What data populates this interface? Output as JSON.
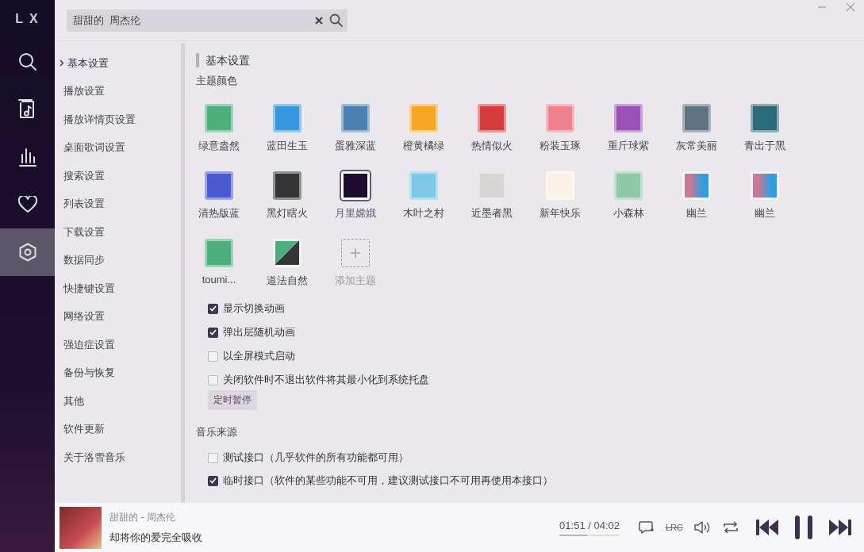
{
  "app_logo": "L X",
  "search": {
    "value": "甜甜的  周杰伦"
  },
  "nav_icons": [
    {
      "kind": "search",
      "selected": false
    },
    {
      "kind": "music-file",
      "selected": false
    },
    {
      "kind": "chart",
      "selected": false
    },
    {
      "kind": "heart",
      "selected": false
    },
    {
      "kind": "settings",
      "selected": true
    }
  ],
  "settings_nav": [
    {
      "label": "基本设置",
      "selected": true
    },
    {
      "label": "播放设置",
      "selected": false
    },
    {
      "label": "播放详情页设置",
      "selected": false
    },
    {
      "label": "桌面歌词设置",
      "selected": false
    },
    {
      "label": "搜索设置",
      "selected": false
    },
    {
      "label": "列表设置",
      "selected": false
    },
    {
      "label": "下载设置",
      "selected": false
    },
    {
      "label": "数据同步",
      "selected": false
    },
    {
      "label": "快捷键设置",
      "selected": false
    },
    {
      "label": "网络设置",
      "selected": false
    },
    {
      "label": "强迫症设置",
      "selected": false
    },
    {
      "label": "备份与恢复",
      "selected": false
    },
    {
      "label": "其他",
      "selected": false
    },
    {
      "label": "软件更新",
      "selected": false
    },
    {
      "label": "关于洛雪音乐",
      "selected": false
    }
  ],
  "section_title": "基本设置",
  "theme_heading": "主题颜色",
  "themes": [
    {
      "name": "绿意盎然",
      "kind": "color",
      "color": "#4daf7c",
      "selected": false
    },
    {
      "name": "蓝田生玉",
      "kind": "color",
      "color": "#3498db",
      "selected": false
    },
    {
      "name": "蛋雅深蓝",
      "kind": "color",
      "color": "#4a81b0",
      "selected": false
    },
    {
      "name": "橙黄橘绿",
      "kind": "color",
      "color": "#f5a623",
      "selected": false
    },
    {
      "name": "热情似火",
      "kind": "color",
      "color": "#d63c3c",
      "selected": false
    },
    {
      "name": "粉装玉琢",
      "kind": "color",
      "color": "#f0808c",
      "selected": false
    },
    {
      "name": "重斤球紫",
      "kind": "color",
      "color": "#9b50b6",
      "selected": false
    },
    {
      "name": "灰常美丽",
      "kind": "color",
      "color": "#637283",
      "selected": false
    },
    {
      "name": "青出于黑",
      "kind": "color",
      "color": "#2b6b78",
      "selected": false
    },
    {
      "name": "清热版蓝",
      "kind": "color",
      "color": "#4a5ad0",
      "selected": false
    },
    {
      "name": "黑灯瞎火",
      "kind": "color",
      "color": "#353535",
      "selected": false
    },
    {
      "name": "月里嫦娥",
      "kind": "image",
      "color": "#1e0d2e",
      "selected": true
    },
    {
      "name": "木叶之村",
      "kind": "image",
      "color": "#7cc6e8",
      "selected": false
    },
    {
      "name": "近墨者黑",
      "kind": "image",
      "color": "#d8d6d4",
      "selected": false
    },
    {
      "name": "新年快乐",
      "kind": "image",
      "color": "#fbf1e4",
      "selected": false
    },
    {
      "name": "小森林",
      "kind": "color",
      "color": "#8ec8a6",
      "selected": false
    },
    {
      "name": "幽兰",
      "kind": "gradient",
      "color": "#c87a96",
      "end": {
        "color": "#2f9ee0"
      },
      "selected": false
    },
    {
      "name": "幽兰",
      "kind": "gradient",
      "color": "#c87a96",
      "end": {
        "color": "#2f9ee0"
      },
      "selected": false
    },
    {
      "name": "toumi...",
      "kind": "color",
      "color": "#4daf7c",
      "selected": false
    },
    {
      "name": "道法自然",
      "kind": "split",
      "color": "#4daf7c",
      "end": {
        "color": "#353535"
      },
      "selected": false
    },
    {
      "name": "添加主题",
      "kind": "add",
      "selected": false
    }
  ],
  "options": [
    {
      "label": "显示切换动画",
      "checked": true
    },
    {
      "label": "弹出层随机动画",
      "checked": true
    },
    {
      "label": "以全屏模式启动",
      "checked": false
    },
    {
      "label": "关闭软件时不退出软件将其最小化到系统托盘",
      "checked": false
    }
  ],
  "timer_button": "定时暂停",
  "source_heading": "音乐来源",
  "sources": [
    {
      "label": "测试接口（几乎软件的所有功能都可用）",
      "checked": false
    },
    {
      "label": "临时接口（软件的某些功能不可用，建议测试接口不可用再使用本接口）",
      "checked": true
    }
  ],
  "player": {
    "track": "甜甜的 - 周杰伦",
    "lyric": "却将你的爱完全吸收",
    "time": "01:51 / 04:02",
    "level": 0.46,
    "lyric_toggle": "LRC"
  }
}
